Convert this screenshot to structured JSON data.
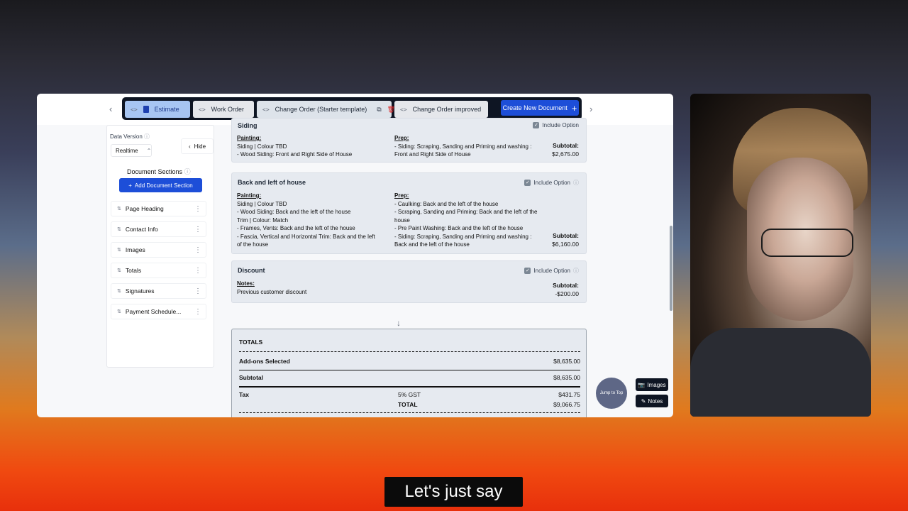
{
  "tabs": [
    {
      "label": "Estimate"
    },
    {
      "label": "Work Order"
    },
    {
      "label": "Change Order (Starter template)"
    },
    {
      "label": "Change Order improved"
    }
  ],
  "create_new": "Create New Document",
  "sidebar": {
    "data_version_label": "Data Version",
    "data_version_value": "Realtime",
    "hide_label": "Hide",
    "sections_title": "Document Sections",
    "add_section": "Add Document Section",
    "items": [
      "Page Heading",
      "Contact Info",
      "Images",
      "Totals",
      "Signatures",
      "Payment Schedule..."
    ]
  },
  "sections": [
    {
      "title": "Siding",
      "include": "Include Option",
      "painting_label": "Painting:",
      "paint_lines": [
        "Siding | Colour TBD",
        "- Wood Siding: Front and Right Side of House"
      ],
      "prep_label": "Prep:",
      "prep_lines": [
        "- Siding: Scraping, Sanding and Priming and washing :",
        "Front and Right Side of House"
      ],
      "subtotal_label": "Subtotal:",
      "subtotal": "$2,675.00"
    },
    {
      "title": "Back and left of house",
      "include": "Include Option",
      "painting_label": "Painting:",
      "paint_lines": [
        "Siding | Colour TBD",
        "- Wood Siding: Back and the left of the house",
        "Trim | Colour: Match",
        "- Frames, Vents: Back and the left of the house",
        "- Fascia, Vertical and Horizontal Trim: Back and the left",
        "of the house"
      ],
      "prep_label": "Prep:",
      "prep_lines": [
        "- Caulking: Back and the left of the house",
        "- Scraping, Sanding and Priming: Back and the left of the",
        "house",
        "- Pre Paint Washing: Back and the left of the house",
        "- Siding: Scraping, Sanding and Priming and washing :",
        "Back and the left of the house"
      ],
      "subtotal_label": "Subtotal:",
      "subtotal": "$6,160.00"
    },
    {
      "title": "Discount",
      "include": "Include Option",
      "notes_label": "Notes:",
      "notes": "Previous customer discount",
      "subtotal_label": "Subtotal:",
      "subtotal": "-$200.00"
    }
  ],
  "totals": {
    "header": "TOTALS",
    "addons_label": "Add-ons Selected",
    "addons_value": "$8,635.00",
    "subtotal_label": "Subtotal",
    "subtotal_value": "$8,635.00",
    "tax_label": "Tax",
    "tax_rate": "5% GST",
    "tax_value": "$431.75",
    "total_label": "TOTAL",
    "total_value": "$9,066.75"
  },
  "floating": {
    "jump": "Jump to Top",
    "images": "Images",
    "notes": "Notes"
  },
  "caption": "Let's just say"
}
